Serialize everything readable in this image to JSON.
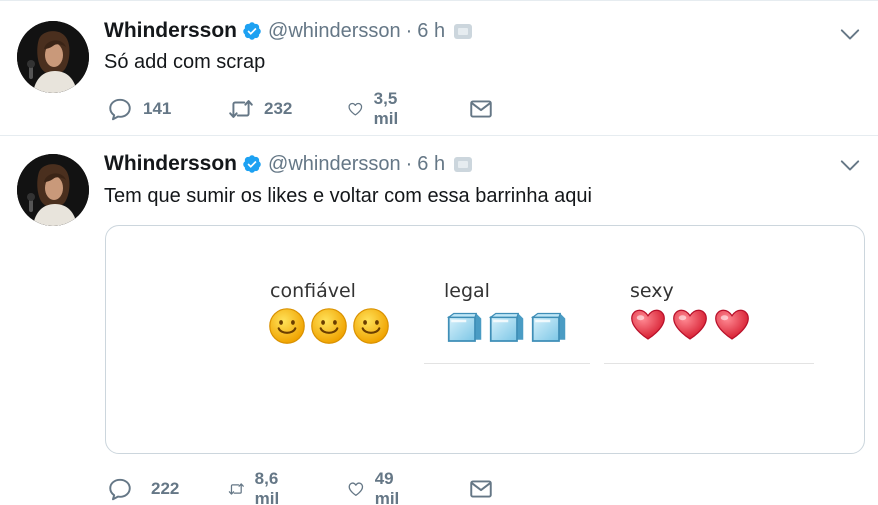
{
  "tweets": [
    {
      "author": {
        "name": "Whindersson",
        "handle": "@whindersson",
        "verified": true
      },
      "separator": "·",
      "time": "6 h",
      "text": "Só add com scrap",
      "actions": {
        "replies": "141",
        "retweets": "232",
        "likes": "3,5 mil"
      }
    },
    {
      "author": {
        "name": "Whindersson",
        "handle": "@whindersson",
        "verified": true
      },
      "separator": "·",
      "time": "6 h",
      "text": "Tem que sumir os likes e voltar com essa barrinha aqui",
      "actions": {
        "replies": "222",
        "retweets": "8,6 mil",
        "likes": "49 mil"
      },
      "media": {
        "meters": [
          {
            "label": "confiável",
            "icon": "smiley-icon",
            "count": 3
          },
          {
            "label": "legal",
            "icon": "ice-cube-icon",
            "count": 3
          },
          {
            "label": "sexy",
            "icon": "heart-icon",
            "count": 3
          }
        ]
      }
    }
  ],
  "colors": {
    "verified": "#1da1f2",
    "muted": "#657786",
    "text": "#14171a",
    "border": "#e6ecf0",
    "smiley": "#f7b500",
    "ice": "#9fd8f0",
    "heart": "#e8394a"
  }
}
